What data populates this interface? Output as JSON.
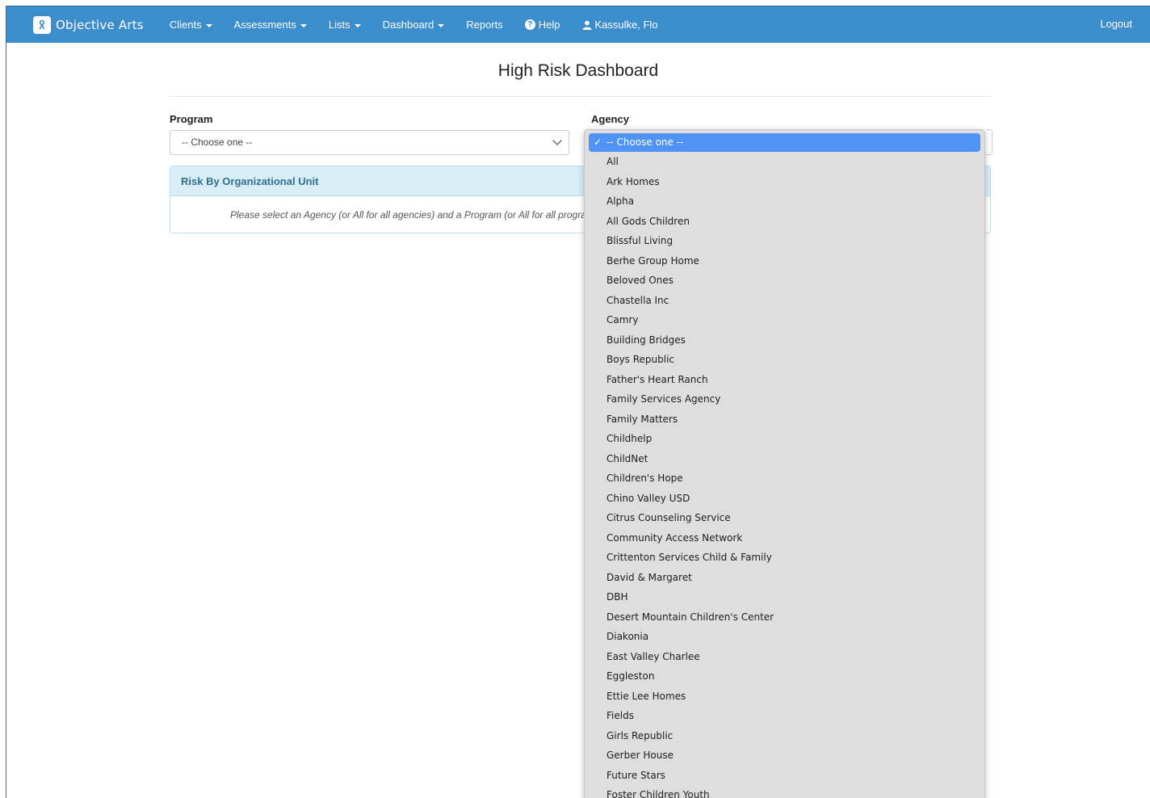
{
  "navbar": {
    "brand": "Objective Arts",
    "items": [
      {
        "label": "Clients",
        "dropdown": true
      },
      {
        "label": "Assessments",
        "dropdown": true
      },
      {
        "label": "Lists",
        "dropdown": true
      },
      {
        "label": "Dashboard",
        "dropdown": true
      },
      {
        "label": "Reports",
        "dropdown": false
      }
    ],
    "help": "Help",
    "user": "Kassulke, Flo",
    "logout": "Logout"
  },
  "page": {
    "title": "High Risk Dashboard"
  },
  "program": {
    "label": "Program",
    "value": "-- Choose one --"
  },
  "agency": {
    "label": "Agency",
    "value": "-- Choose one --"
  },
  "panel": {
    "heading": "Risk By Organizational Unit",
    "message": "Please select an Agency (or All for all agencies) and a Program (or All for all programs)"
  },
  "agency_dropdown": {
    "selected": "-- Choose one --",
    "options": [
      "All",
      "Ark Homes",
      "Alpha",
      "All Gods Children",
      "Blissful Living",
      "Berhe Group Home",
      "Beloved Ones",
      "Chastella Inc",
      "Camry",
      "Building Bridges",
      "Boys Republic",
      "Father's Heart Ranch",
      "Family Services Agency",
      "Family Matters",
      "Childhelp",
      "ChildNet",
      "Children's Hope",
      "Chino Valley USD",
      "Citrus Counseling Service",
      "Community Access Network",
      "Crittenton Services Child & Family",
      "David & Margaret",
      "DBH",
      "Desert Mountain Children's Center",
      "Diakonia",
      "East Valley Charlee",
      "Eggleston",
      "Ettie Lee Homes",
      "Fields",
      "Girls Republic",
      "Gerber House",
      "Future Stars",
      "Foster Children Youth"
    ]
  },
  "colors": {
    "navbar": "#3c8dcb",
    "panel_heading_bg": "#d9edf7",
    "panel_heading_text": "#31708f",
    "selected_option": "#4f94f5"
  }
}
